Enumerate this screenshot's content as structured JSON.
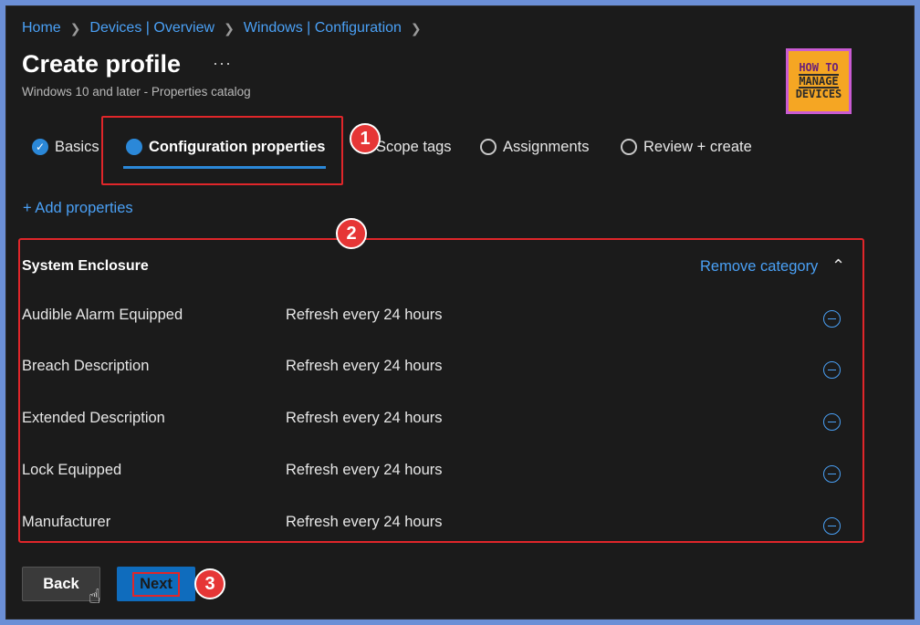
{
  "breadcrumb": [
    "Home",
    "Devices | Overview",
    "Windows | Configuration"
  ],
  "page": {
    "title": "Create profile",
    "more": "···",
    "subtitle": "Windows 10 and later - Properties catalog"
  },
  "logo": {
    "line1": "HOW TO",
    "line2": "MANAGE",
    "line3": "DEVICES"
  },
  "tabs": [
    {
      "label": "Basics",
      "state": "done"
    },
    {
      "label": "Configuration properties",
      "state": "active"
    },
    {
      "label": "Scope tags",
      "state": "pending"
    },
    {
      "label": "Assignments",
      "state": "pending"
    },
    {
      "label": "Review + create",
      "state": "pending"
    }
  ],
  "add_properties": "+ Add properties",
  "category": {
    "title": "System Enclosure",
    "remove_label": "Remove category",
    "rows": [
      {
        "name": "Audible Alarm Equipped",
        "value": "Refresh every 24 hours"
      },
      {
        "name": "Breach Description",
        "value": "Refresh every 24 hours"
      },
      {
        "name": "Extended Description",
        "value": "Refresh every 24 hours"
      },
      {
        "name": "Lock Equipped",
        "value": "Refresh every 24 hours"
      },
      {
        "name": "Manufacturer",
        "value": "Refresh every 24 hours"
      }
    ]
  },
  "annotations": [
    "1",
    "2",
    "3"
  ],
  "footer": {
    "back_label": "Back",
    "next_label": "Next"
  },
  "colors": {
    "accent": "#2b88d8",
    "link": "#4aa0f5",
    "annotation": "#e0262a",
    "background": "#1b1b1b"
  }
}
